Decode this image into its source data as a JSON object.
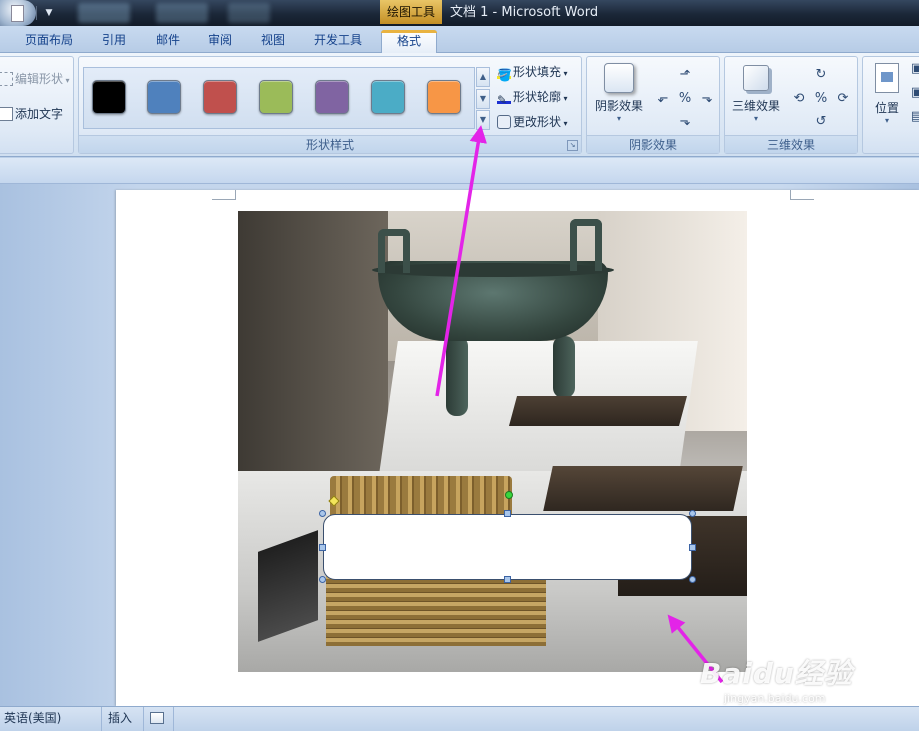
{
  "titlebar": {
    "context_tab": "绘图工具",
    "document_title": "文档 1 - Microsoft Word"
  },
  "ribbon_tabs": [
    {
      "label": "页面布局"
    },
    {
      "label": "引用"
    },
    {
      "label": "邮件"
    },
    {
      "label": "审阅"
    },
    {
      "label": "视图"
    },
    {
      "label": "开发工具"
    },
    {
      "label": "格式",
      "active": true
    }
  ],
  "insert_shapes_group": {
    "edit_shape": "编辑形状",
    "add_text": "添加文字"
  },
  "shape_styles_group": {
    "label": "形状样式",
    "swatches": [
      "#000000",
      "#4f81bd",
      "#c0504d",
      "#9bbb59",
      "#8064a2",
      "#4bacc6",
      "#f79646"
    ],
    "shape_fill": "形状填充",
    "shape_outline": "形状轮廓",
    "change_shape": "更改形状"
  },
  "shadow_effects_group": {
    "label": "阴影效果",
    "button": "阴影效果"
  },
  "three_d_effects_group": {
    "label": "三维效果",
    "button": "三维效果"
  },
  "arrange_group": {
    "position": "位置"
  },
  "document": {
    "image_description_hidden": ""
  },
  "watermark": {
    "main": "Baidu经验",
    "sub": "jingyan.baidu.com"
  },
  "statusbar": {
    "language": "英语(美国)",
    "mode": "插入"
  },
  "colors": {
    "annotation_arrow": "#e324e8",
    "active_tab_accent": "#e9b340"
  }
}
